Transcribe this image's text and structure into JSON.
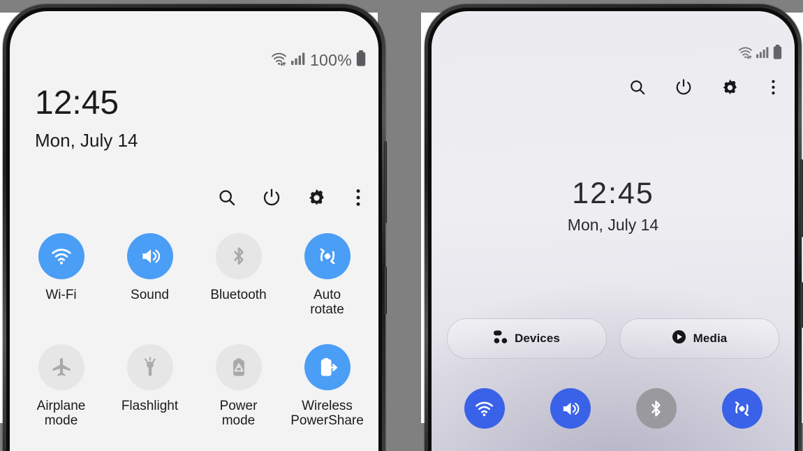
{
  "background_color": "#808080",
  "left_phone": {
    "name": "samsung-quick-settings-expanded",
    "screen_bg": "#f3f3f4",
    "accent_on": "#4a9ef5",
    "accent_off_bg": "#e6e6e6",
    "accent_off_fg": "#a9a9a9",
    "statusbar": {
      "wifi_icon": "wifi-icon",
      "signal_icon": "signal-bars-icon",
      "battery_percent": "100%",
      "battery_icon": "battery-full-icon"
    },
    "clock": {
      "time": "12:45",
      "date": "Mon, July 14"
    },
    "actions": [
      {
        "name": "search-icon",
        "label": "Search"
      },
      {
        "name": "power-icon",
        "label": "Power"
      },
      {
        "name": "gear-icon",
        "label": "Settings"
      },
      {
        "name": "more-vertical-icon",
        "label": "More options"
      }
    ],
    "toggles": [
      {
        "icon": "wifi-icon",
        "label": "Wi-Fi",
        "on": true
      },
      {
        "icon": "sound-icon",
        "label": "Sound",
        "on": true
      },
      {
        "icon": "bluetooth-icon",
        "label": "Bluetooth",
        "on": false
      },
      {
        "icon": "auto-rotate-icon",
        "label": "Auto\nrotate",
        "on": true
      },
      {
        "icon": "airplane-icon",
        "label": "Airplane\nmode",
        "on": false
      },
      {
        "icon": "flashlight-icon",
        "label": "Flashlight",
        "on": false
      },
      {
        "icon": "power-mode-icon",
        "label": "Power\nmode",
        "on": false
      },
      {
        "icon": "wireless-powershare-icon",
        "label": "Wireless\nPowerShare",
        "on": true
      }
    ]
  },
  "right_phone": {
    "name": "samsung-quick-settings-oneui-panel",
    "accent_on": "#3a62e8",
    "accent_off_bg": "#9a9a9e",
    "accent_off_fg": "#ffffff",
    "statusbar": {
      "wifi_icon": "wifi-icon",
      "signal_icon": "signal-bars-icon",
      "battery_icon": "battery-full-icon"
    },
    "actions": [
      {
        "name": "search-icon",
        "label": "Search"
      },
      {
        "name": "power-icon",
        "label": "Power"
      },
      {
        "name": "gear-icon",
        "label": "Settings"
      },
      {
        "name": "more-vertical-icon",
        "label": "More options"
      }
    ],
    "clock": {
      "time": "12:45",
      "date": "Mon, July 14"
    },
    "pills": [
      {
        "icon": "devices-grid-icon",
        "label": "Devices"
      },
      {
        "icon": "media-play-icon",
        "label": "Media"
      }
    ],
    "toggles": [
      {
        "icon": "wifi-icon",
        "label": "Wi-Fi",
        "on": true
      },
      {
        "icon": "sound-icon",
        "label": "Sound",
        "on": true
      },
      {
        "icon": "bluetooth-icon",
        "label": "Bluetooth",
        "on": false
      },
      {
        "icon": "auto-rotate-icon",
        "label": "Auto rotate",
        "on": true
      }
    ]
  }
}
